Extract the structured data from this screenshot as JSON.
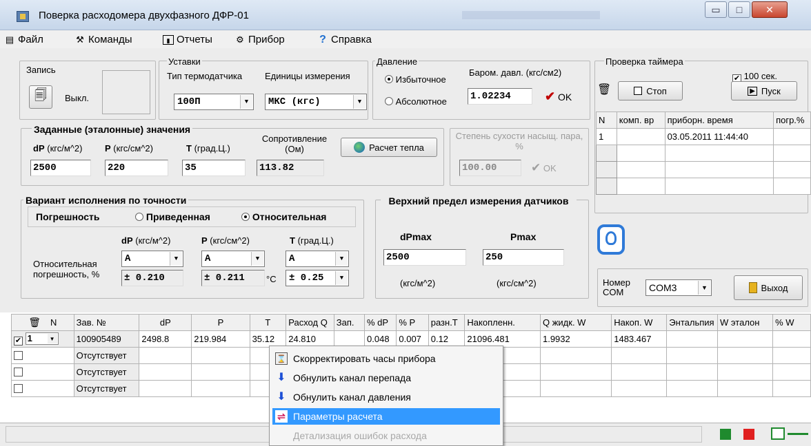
{
  "window": {
    "title": "Поверка расходомера двухфазного ДФР-01",
    "minimize_label": "▭",
    "maximize_label": "□",
    "close_label": "✕"
  },
  "menu": [
    {
      "label": "Файл",
      "icon": "document-icon"
    },
    {
      "label": "Команды",
      "icon": "tools-icon"
    },
    {
      "label": "Отчеты",
      "icon": "report-icon"
    },
    {
      "label": "Прибор",
      "icon": "device-icon"
    },
    {
      "label": "Справка",
      "icon": "help-icon"
    }
  ],
  "record": {
    "legend": "Запись",
    "state": "Выкл."
  },
  "settings": {
    "legend": "Уставки",
    "sensor_type_label": "Тип термодатчика",
    "sensor_type_value": "100П",
    "units_label": "Единицы измерения",
    "units_value": "МКС (кгс)"
  },
  "pressure": {
    "legend": "Давление",
    "excess_label": "Избыточное",
    "absolute_label": "Абсолютное",
    "selected": "excess",
    "barom_label": "Бaром. давл. (кгс/см2)",
    "barom_value": "1.02234",
    "ok_label": "OK"
  },
  "timer": {
    "legend": "Проверка таймера",
    "chk_label": "100 сек.",
    "chk_checked": true,
    "stop_label": "Стоп",
    "start_label": "Пуск",
    "columns": [
      "N",
      "комп. вр",
      "приборн. время",
      "погр.%"
    ],
    "rows": [
      [
        "1",
        "",
        "03.05.2011 11:44:40",
        ""
      ],
      [
        "",
        "",
        "",
        ""
      ],
      [
        "",
        "",
        "",
        ""
      ],
      [
        "",
        "",
        "",
        ""
      ]
    ]
  },
  "reference": {
    "legend": "Заданные (эталонные) значения",
    "dp_label": "dP",
    "dp_unit": "(кгс/м^2)",
    "p_label": "P",
    "p_unit": "(кгс/см^2)",
    "t_label": "T",
    "t_unit": "(град.Ц.)",
    "res_label": "Сопротивление (Ом)",
    "dp_value": "2500",
    "p_value": "220",
    "t_value": "35",
    "res_value": "113.82",
    "calc_button": "Расчет тепла"
  },
  "dryness": {
    "label": "Степень сухости насыщ. пара, %",
    "value": "100.00",
    "ok_label": "OK"
  },
  "accuracy": {
    "legend": "Вариант исполнения по точности",
    "error_label": "Погрешность",
    "reduced_label": "Приведенная",
    "relative_label": "Относительная",
    "selected": "relative",
    "dp_col": "dP",
    "dp_unit": "(кгс/м^2)",
    "p_col": "P",
    "p_unit": "(кгс/см^2)",
    "t_col": "T",
    "t_unit": "(град.Ц.)",
    "row_label": "Относительная погрешность, %",
    "dp_class": "A",
    "p_class": "A",
    "t_class": "A",
    "dp_err": "± 0.210",
    "p_err": "± 0.211",
    "t_unit_sym": "°C",
    "t_err": "± 0.25"
  },
  "limits": {
    "legend": "Верхний предел измерения датчиков",
    "dpmax_label": "dPmax",
    "pmax_label": "Pmax",
    "dpmax_value": "2500",
    "pmax_value": "250",
    "dp_unit": "(кгс/м^2)",
    "p_unit": "(кгс/см^2)"
  },
  "com": {
    "label": "Номер COM",
    "value": "COM3",
    "exit_label": "Выход"
  },
  "grid": {
    "columns": [
      "N",
      "Зав. №",
      "dP",
      "P",
      "T",
      "Расход Q",
      "Зап.",
      "% dP",
      "% P",
      "разн.T",
      "Накопленн.",
      "Q жидк. W",
      "Накоп. W",
      "Энтальпия",
      "W эталон",
      "% W"
    ],
    "rows": [
      {
        "checked": true,
        "n": "1",
        "serial": "100905489",
        "dp": "2498.8",
        "p": "219.984",
        "t": "35.12",
        "q": "24.810",
        "zap": "",
        "pdp": "0.048",
        "pp": "0.007",
        "dt": "0.12",
        "acc": "21096.481",
        "qw": "1.9932",
        "accw": "1483.467",
        "ent": "",
        "wref": "",
        "pw": ""
      },
      {
        "checked": false,
        "n": "",
        "serial": "Отсутствует",
        "dp": "",
        "p": "",
        "t": "",
        "q": "",
        "zap": "",
        "pdp": "",
        "pp": "",
        "dt": "",
        "acc": "",
        "qw": "",
        "accw": "",
        "ent": "",
        "wref": "",
        "pw": ""
      },
      {
        "checked": false,
        "n": "",
        "serial": "Отсутствует",
        "dp": "",
        "p": "",
        "t": "",
        "q": "",
        "zap": "",
        "pdp": "",
        "pp": "",
        "dt": "",
        "acc": "",
        "qw": "",
        "accw": "",
        "ent": "",
        "wref": "",
        "pw": ""
      },
      {
        "checked": false,
        "n": "",
        "serial": "Отсутствует",
        "dp": "",
        "p": "",
        "t": "",
        "q": "",
        "zap": "",
        "pdp": "",
        "pp": "",
        "dt": "",
        "acc": "",
        "qw": "",
        "accw": "",
        "ent": "",
        "wref": "",
        "pw": ""
      }
    ]
  },
  "context_menu": [
    {
      "label": "Скорректировать часы прибора",
      "icon": "clock-icon",
      "state": "normal"
    },
    {
      "label": "Обнулить канал перепада",
      "icon": "arrow-down-icon",
      "state": "normal"
    },
    {
      "label": "Обнулить канал давления",
      "icon": "arrow-down-icon",
      "state": "normal"
    },
    {
      "label": "Параметры расчета",
      "icon": "settings-icon",
      "state": "highlighted"
    },
    {
      "label": "Детализация ошибок расхода",
      "icon": "",
      "state": "disabled"
    }
  ],
  "colors": {
    "accent_highlight": "#3399ff",
    "status_green": "#1f8a2e",
    "status_red": "#e02020",
    "ok_check": "#c00000"
  }
}
